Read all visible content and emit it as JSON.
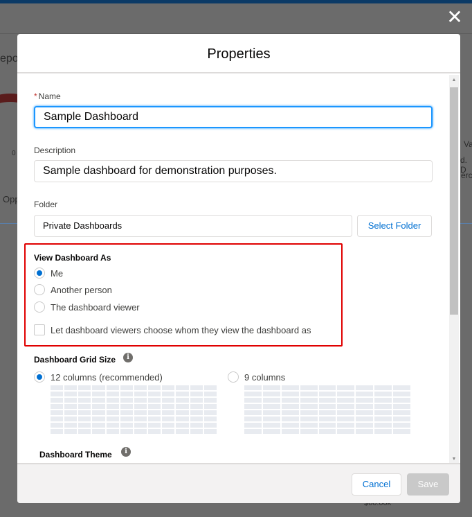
{
  "background": {
    "fragments": [
      "epo",
      "0",
      "Opp",
      "Va",
      "d. D",
      "erc",
      "$60.00k"
    ]
  },
  "close_icon": "✕",
  "modal": {
    "title": "Properties",
    "name": {
      "label": "Name",
      "required_marker": "*",
      "value": "Sample Dashboard"
    },
    "description": {
      "label": "Description",
      "value": "Sample dashboard for demonstration purposes."
    },
    "folder": {
      "label": "Folder",
      "value": "Private Dashboards",
      "button": "Select Folder"
    },
    "view_as": {
      "heading": "View Dashboard As",
      "options": [
        {
          "label": "Me",
          "selected": true
        },
        {
          "label": "Another person",
          "selected": false
        },
        {
          "label": "The dashboard viewer",
          "selected": false
        }
      ],
      "checkbox": {
        "label": "Let dashboard viewers choose whom they view the dashboard as",
        "checked": false
      },
      "highlight_color": "#e00000"
    },
    "grid_size": {
      "heading": "Dashboard Grid Size",
      "options": [
        {
          "label": "12 columns (recommended)",
          "selected": true,
          "columns": 12,
          "rows": 8
        },
        {
          "label": "9 columns",
          "selected": false,
          "columns": 9,
          "rows": 8
        }
      ]
    },
    "theme": {
      "heading": "Dashboard Theme"
    },
    "footer": {
      "cancel": "Cancel",
      "save": "Save",
      "save_enabled": false
    }
  },
  "colors": {
    "accent": "#0070d2",
    "focus": "#1b96ff",
    "overlay": "#6b6b6b"
  }
}
